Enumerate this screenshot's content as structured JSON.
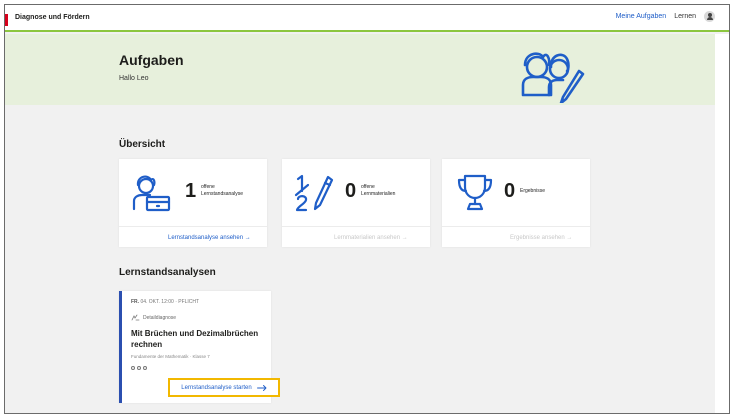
{
  "topbar": {
    "brand": "Diagnose und Fördern",
    "nav_tasks": "Meine Aufgaben",
    "nav_learn": "Lernen"
  },
  "hero": {
    "title": "Aufgaben",
    "greeting": "Hallo Leo"
  },
  "overview": {
    "title": "Übersicht",
    "cards": [
      {
        "count": "1",
        "label_line1": "offene",
        "label_line2": "Lernstandsanalyse",
        "link": "Lernstandsanalyse ansehen →",
        "link_enabled": true
      },
      {
        "count": "0",
        "label_line1": "offene",
        "label_line2": "Lernmaterialien",
        "link": "Lernmaterialien ansehen →",
        "link_enabled": false
      },
      {
        "count": "0",
        "label_line1": "Ergebnisse",
        "label_line2": "",
        "link": "Ergebnisse ansehen →",
        "link_enabled": false
      }
    ]
  },
  "analyses": {
    "title": "Lernstandsanalysen",
    "items": [
      {
        "day": "FR.",
        "date": "04. OKT. 12:00 · PFLICHT",
        "type": "Detaildiagnose",
        "title": "Mit Brüchen und Dezimalbrüchen rechnen",
        "meta": "Fundamente der Mathematik · Klasse 7",
        "start_label": "Lernstandsanalyse starten"
      }
    ]
  },
  "colors": {
    "accent_blue": "#1f5ec8",
    "hero_green": "#e7f0dc",
    "topbar_line": "#8cc63f",
    "highlight": "#f2b800",
    "card_stripe": "#2b4fb0"
  },
  "icons": {
    "hero": "students-pencil-icon",
    "card1": "student-desk-icon",
    "card2": "fraction-pencil-icon",
    "card3": "trophy-icon",
    "type": "detail-diagnosis-icon",
    "user": "user-icon",
    "arrow": "arrow-right-icon"
  }
}
